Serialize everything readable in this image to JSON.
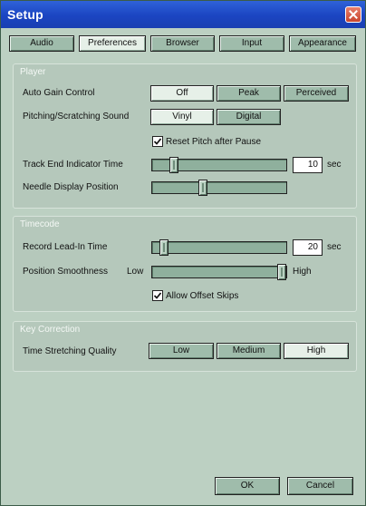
{
  "window": {
    "title": "Setup"
  },
  "tabs": [
    {
      "label": "Audio",
      "selected": false
    },
    {
      "label": "Preferences",
      "selected": true
    },
    {
      "label": "Browser",
      "selected": false
    },
    {
      "label": "Input",
      "selected": false
    },
    {
      "label": "Appearance",
      "selected": false
    }
  ],
  "player": {
    "title": "Player",
    "auto_gain": {
      "label": "Auto Gain Control",
      "options": [
        "Off",
        "Peak",
        "Perceived"
      ],
      "selected": "Off"
    },
    "pitching": {
      "label": "Pitching/Scratching Sound",
      "options": [
        "Vinyl",
        "Digital"
      ],
      "selected": "Vinyl"
    },
    "reset_pitch": {
      "label": "Reset Pitch after Pause",
      "checked": true
    },
    "track_end": {
      "label": "Track End Indicator Time",
      "value": "10",
      "unit": "sec",
      "level": 0.14
    },
    "needle": {
      "label": "Needle Display Position",
      "level": 0.37
    }
  },
  "timecode": {
    "title": "Timecode",
    "lead_in": {
      "label": "Record Lead-In Time",
      "value": "20",
      "unit": "sec",
      "level": 0.06
    },
    "smoothness": {
      "label": "Position Smoothness",
      "low": "Low",
      "high": "High",
      "level": 1.0
    },
    "offset_skips": {
      "label": "Allow Offset Skips",
      "checked": true
    }
  },
  "key_correction": {
    "title": "Key Correction",
    "quality": {
      "label": "Time Stretching Quality",
      "options": [
        "Low",
        "Medium",
        "High"
      ],
      "selected": "High"
    }
  },
  "footer": {
    "ok": "OK",
    "cancel": "Cancel"
  },
  "colors": {
    "titlebar": "#1b45c2",
    "dialog_bg": "#bcd0c2",
    "button": "#9fbcab",
    "button_selected": "#e6f0e8"
  }
}
